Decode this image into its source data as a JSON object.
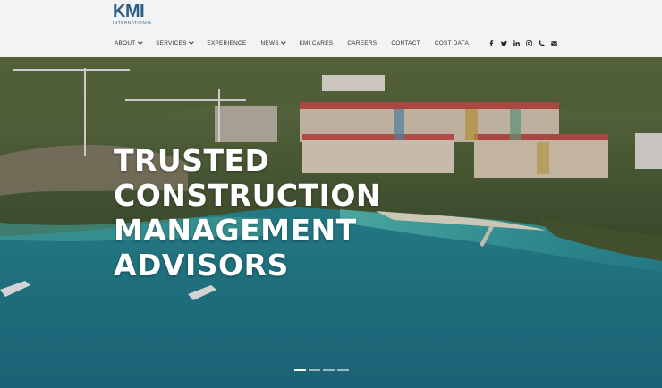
{
  "logo": {
    "mark": "KMI",
    "sub": "INTERNATIONAL"
  },
  "nav": {
    "items": [
      {
        "label": "ABOUT",
        "dropdown": true
      },
      {
        "label": "SERVICES",
        "dropdown": true
      },
      {
        "label": "EXPERIENCE",
        "dropdown": false
      },
      {
        "label": "NEWS",
        "dropdown": true
      },
      {
        "label": "KMI CARES",
        "dropdown": false
      },
      {
        "label": "CAREERS",
        "dropdown": false
      },
      {
        "label": "CONTACT",
        "dropdown": false
      },
      {
        "label": "COST DATA",
        "dropdown": false
      }
    ],
    "social": [
      "facebook-icon",
      "twitter-icon",
      "linkedin-icon",
      "instagram-icon",
      "phone-icon",
      "email-icon"
    ]
  },
  "hero": {
    "headline": [
      "TRUSTED",
      "CONSTRUCTION",
      "MANAGEMENT",
      "ADVISORS"
    ],
    "slide_count": 4,
    "active_slide": 1
  },
  "colors": {
    "brand": "#2b5f85",
    "header_bg": "#f3f3f3",
    "headline": "#ffffff"
  }
}
